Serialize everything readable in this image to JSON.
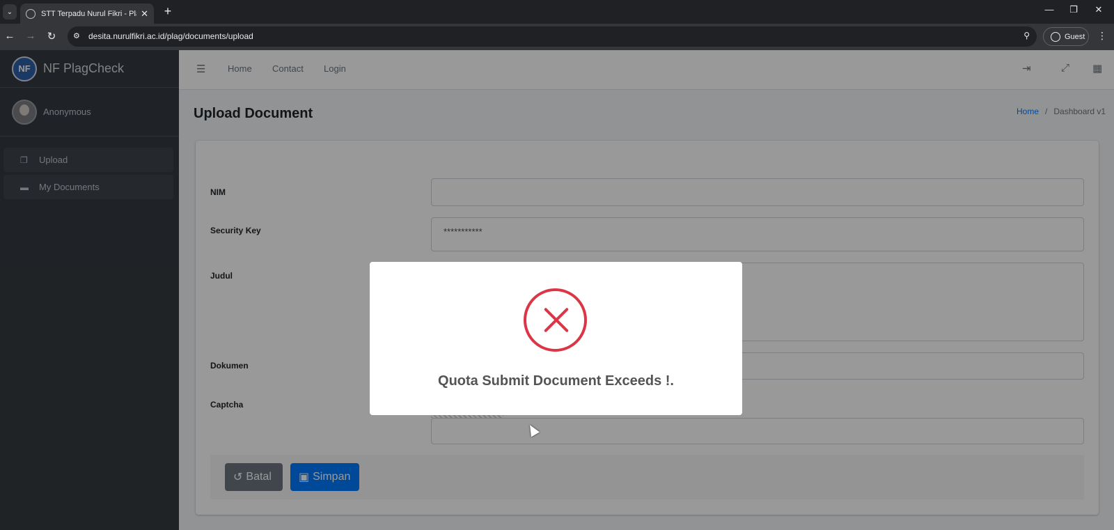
{
  "browser": {
    "tab_title": "STT Terpadu Nurul Fikri - Plagia",
    "url": "desita.nurulfikri.ac.id/plag/documents/upload",
    "profile_label": "Guest"
  },
  "sidebar": {
    "brand": "NF PlagCheck",
    "user_name": "Anonymous",
    "items": [
      {
        "label": "Upload",
        "icon": "copy-icon"
      },
      {
        "label": "My Documents",
        "icon": "folder-icon"
      }
    ]
  },
  "topnav": {
    "links": [
      "Home",
      "Contact",
      "Login"
    ]
  },
  "header": {
    "title": "Upload Document",
    "breadcrumb": [
      "Home",
      "Dashboard v1"
    ]
  },
  "form": {
    "fields": [
      {
        "label": "NIM",
        "value": ""
      },
      {
        "label": "Security Key",
        "value": "***********"
      },
      {
        "label": "Judul",
        "value": ""
      },
      {
        "label": "Dokumen",
        "value": ""
      },
      {
        "label": "Captcha",
        "value": ""
      }
    ],
    "buttons": {
      "cancel": "Batal",
      "save": "Simpan"
    }
  },
  "modal": {
    "icon": "error-icon",
    "message": "Quota Submit Document Exceeds !.",
    "accent_color": "#dc3545"
  }
}
